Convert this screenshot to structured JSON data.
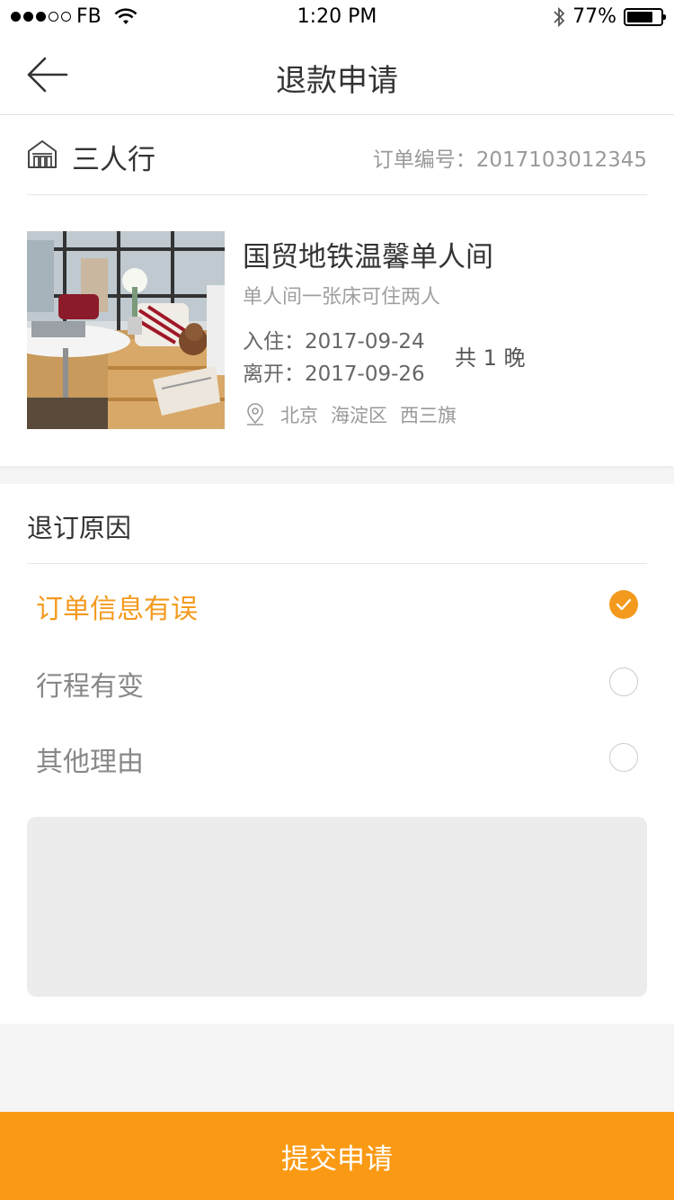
{
  "status_bar": {
    "carrier": "FB",
    "time": "1:20 PM",
    "battery_percent": "77%",
    "battery_level": 0.77
  },
  "nav": {
    "title": "退款申请",
    "back_icon": "back-arrow-icon"
  },
  "order": {
    "shop_name": "三人行",
    "shop_icon": "house-icon",
    "order_number_label": "订单编号：2017103012345",
    "room_title": "国贸地铁温馨单人间",
    "room_desc": "单人间一张床可住两人",
    "checkin": "入住：2017-09-24",
    "checkout": "离开：2017-09-26",
    "nights": "共 1 晚",
    "location_icon": "location-pin-icon",
    "location": [
      "北京",
      "海淀区",
      "西三旗"
    ]
  },
  "reasons": {
    "title": "退订原因",
    "options": [
      {
        "label": "订单信息有误",
        "selected": true
      },
      {
        "label": "行程有变",
        "selected": false
      },
      {
        "label": "其他理由",
        "selected": false
      }
    ],
    "textarea_value": ""
  },
  "submit_label": "提交申请",
  "colors": {
    "accent": "#f39a1e",
    "button": "#fa9a14",
    "background": "#f5f5f5"
  }
}
